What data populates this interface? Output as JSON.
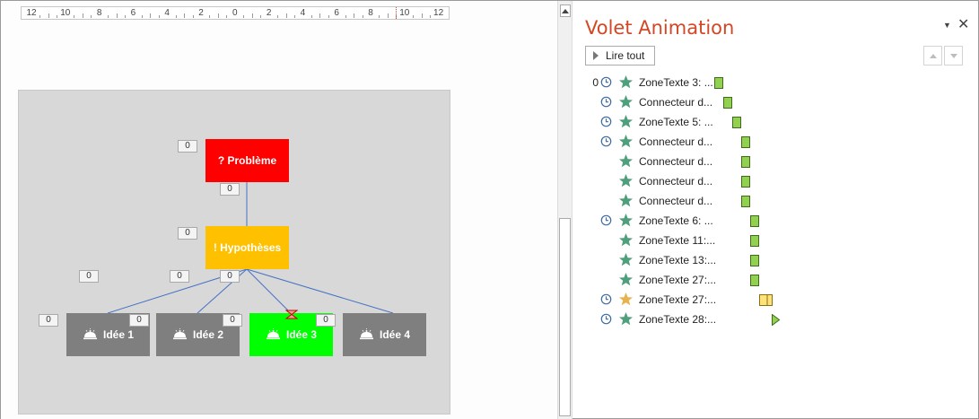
{
  "ruler": {
    "labels": [
      "12",
      "10",
      "8",
      "6",
      "4",
      "2",
      "0",
      "2",
      "4",
      "6",
      "8",
      "10",
      "12"
    ]
  },
  "slide": {
    "probleme": "? Problème",
    "hypotheses": "! Hypothèses",
    "ideas": [
      "Idée 1",
      "Idée 2",
      "Idée 3",
      "Idée 4"
    ],
    "colors": {
      "probleme": "#ff0000",
      "hypotheses": "#ffc000",
      "idea": "#7f7f7f",
      "idea3": "#00ff00",
      "background": "#d8d8d8"
    },
    "tags": [
      "0",
      "0",
      "0",
      "0",
      "0",
      "0",
      "0",
      "0",
      "0",
      "0",
      "0"
    ]
  },
  "pane": {
    "title": "Volet Animation",
    "play_all": "Lire tout",
    "items": [
      {
        "num": "0",
        "clock": true,
        "star": "green",
        "label": "ZoneTexte 3: ...",
        "bar": "rect-green"
      },
      {
        "num": "",
        "clock": true,
        "star": "green",
        "label": "Connecteur d...",
        "bar": "rect-green"
      },
      {
        "num": "",
        "clock": true,
        "star": "green",
        "label": "ZoneTexte 5:  ...",
        "bar": "rect-green"
      },
      {
        "num": "",
        "clock": true,
        "star": "green",
        "label": "Connecteur d...",
        "bar": "rect-green"
      },
      {
        "num": "",
        "clock": false,
        "star": "green",
        "label": "Connecteur d...",
        "bar": "rect-green"
      },
      {
        "num": "",
        "clock": false,
        "star": "green",
        "label": "Connecteur d...",
        "bar": "rect-green"
      },
      {
        "num": "",
        "clock": false,
        "star": "green",
        "label": "Connecteur d...",
        "bar": "rect-green"
      },
      {
        "num": "",
        "clock": true,
        "star": "green",
        "label": "ZoneTexte 6: ...",
        "bar": "rect-green"
      },
      {
        "num": "",
        "clock": false,
        "star": "green",
        "label": "ZoneTexte 11:...",
        "bar": "rect-green"
      },
      {
        "num": "",
        "clock": false,
        "star": "green",
        "label": "ZoneTexte 13:...",
        "bar": "rect-green"
      },
      {
        "num": "",
        "clock": false,
        "star": "green",
        "label": "ZoneTexte 27:...",
        "bar": "rect-green"
      },
      {
        "num": "",
        "clock": true,
        "star": "gold",
        "label": "ZoneTexte 27:...",
        "bar": "rect-yellow"
      },
      {
        "num": "",
        "clock": true,
        "star": "green",
        "label": "ZoneTexte 28:...",
        "bar": "triangle-green"
      }
    ],
    "colors": {
      "title": "#d24726",
      "star_green": "#4f9e7c",
      "star_gold": "#e6b34f",
      "bar_green": "#92d050",
      "bar_yellow": "#ffe37a",
      "clock": "#3d6aa0"
    }
  }
}
